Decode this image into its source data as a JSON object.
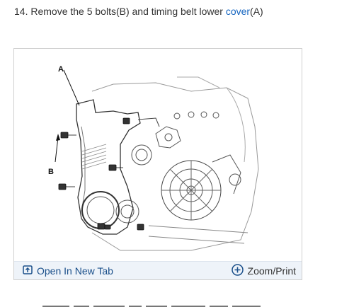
{
  "step": {
    "prefix": "14. Remove the 5 bolts(B) and timing belt lower ",
    "link_text": "cover",
    "suffix": "(A)"
  },
  "figure": {
    "label_a": "A",
    "label_b": "B"
  },
  "toolbar": {
    "open_tab_label": "Open In New Tab",
    "zoom_label": "Zoom/Print"
  },
  "colors": {
    "link": "#1565c0",
    "toolbar_bg": "#eef3f9",
    "icon": "#1a4f8a"
  },
  "icons": {
    "open_tab": "open-in-new-tab-icon",
    "zoom": "zoom-plus-circle-icon"
  }
}
